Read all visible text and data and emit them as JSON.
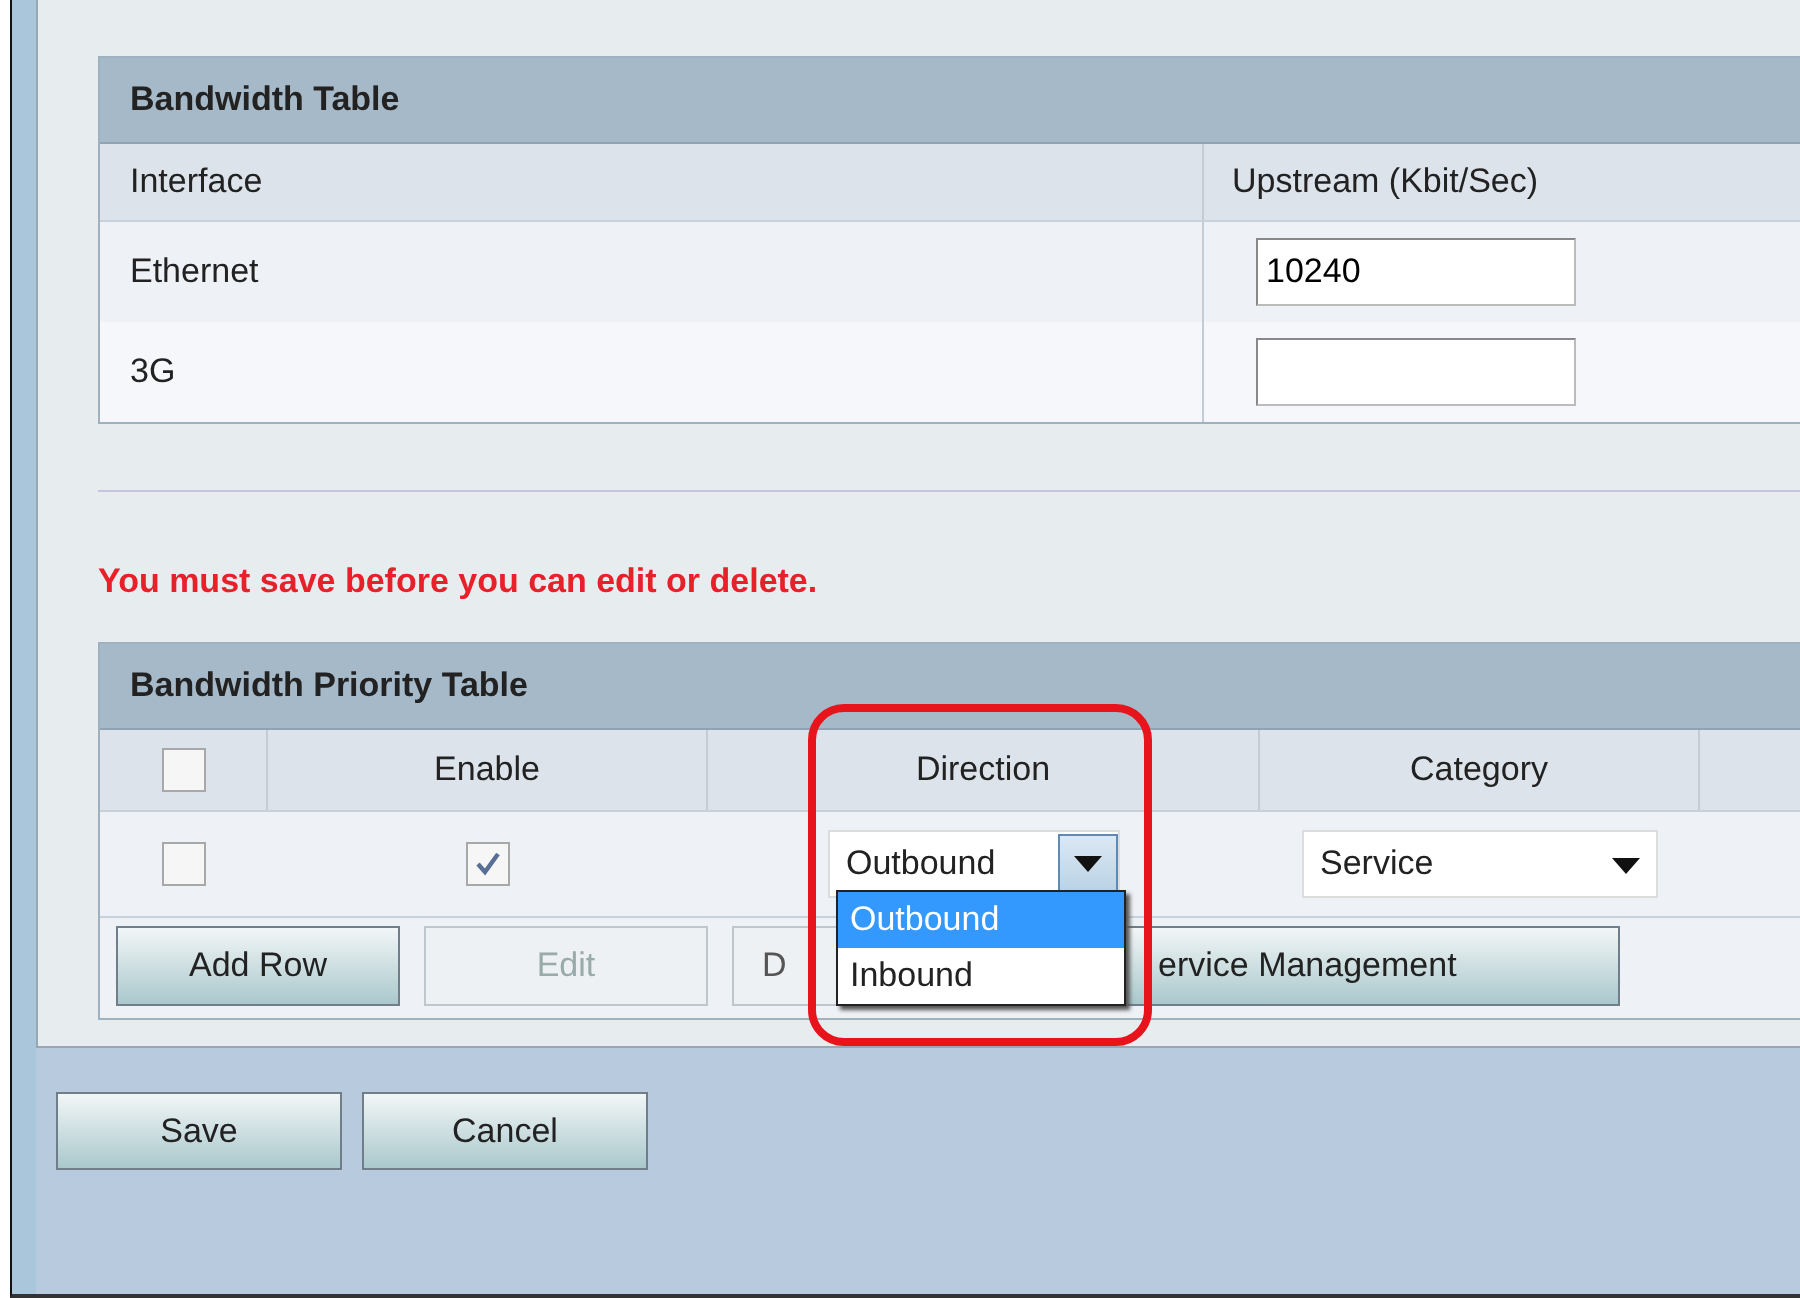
{
  "bandwidth_table": {
    "title": "Bandwidth Table",
    "columns": [
      "Interface",
      "Upstream (Kbit/Sec)"
    ],
    "rows": [
      {
        "interface": "Ethernet",
        "upstream": "10240"
      },
      {
        "interface": "3G"
      }
    ]
  },
  "notice": "You must save before you can edit or delete.",
  "priority_table": {
    "title": "Bandwidth Priority Table",
    "select_all": {
      "checked": false
    },
    "columns": [
      "Enable",
      "Direction",
      "Category"
    ],
    "rows": [
      {
        "checked": false,
        "enable": true,
        "direction": "Outbound",
        "category": "Service"
      }
    ],
    "direction_dropdown": {
      "expanded": true,
      "options": [
        {
          "label": "Outbound",
          "selected": true
        },
        {
          "label": "Inbound",
          "selected": false
        }
      ]
    },
    "buttons": [
      {
        "label": "Add Row",
        "disabled": false
      },
      {
        "label": "Edit",
        "disabled": true
      },
      {
        "label": "D",
        "disabled": true
      },
      {
        "label": "ervice Management",
        "disabled": false
      }
    ]
  },
  "form_buttons": [
    "Save",
    "Cancel"
  ]
}
